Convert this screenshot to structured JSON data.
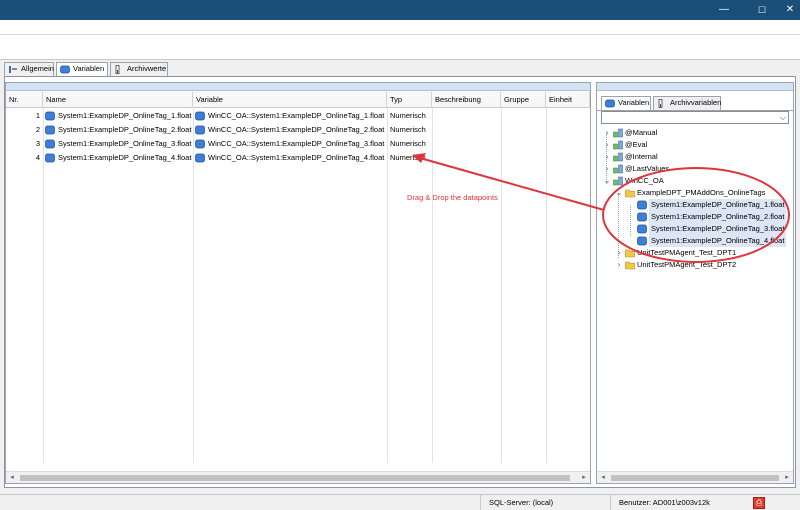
{
  "window": {
    "min_icon": "—",
    "max_icon": "☐",
    "close_icon": "✕"
  },
  "tabs": [
    {
      "label": "Allgemein",
      "icon": "tool-icon"
    },
    {
      "label": "Variablen",
      "icon": "database-icon",
      "active": true
    },
    {
      "label": "Archivwerte",
      "icon": "archive-icon"
    }
  ],
  "grid": {
    "columns": [
      "Nr.",
      "Name",
      "Variable",
      "Typ",
      "Beschreibung",
      "Gruppe",
      "Einheit"
    ],
    "rows": [
      {
        "nr": "1",
        "name": "System1:ExampleDP_OnlineTag_1.float",
        "variable": "WinCC_OA::System1:ExampleDP_OnlineTag_1.float",
        "typ": "Numerisch"
      },
      {
        "nr": "2",
        "name": "System1:ExampleDP_OnlineTag_2.float",
        "variable": "WinCC_OA::System1:ExampleDP_OnlineTag_2.float",
        "typ": "Numerisch"
      },
      {
        "nr": "3",
        "name": "System1:ExampleDP_OnlineTag_3.float",
        "variable": "WinCC_OA::System1:ExampleDP_OnlineTag_3.float",
        "typ": "Numerisch"
      },
      {
        "nr": "4",
        "name": "System1:ExampleDP_OnlineTag_4.float",
        "variable": "WinCC_OA::System1:ExampleDP_OnlineTag_4.float",
        "typ": "Numerisch"
      }
    ],
    "scroll_left": "◂",
    "scroll_right": "▸"
  },
  "annotation": {
    "text": "Drag & Drop the datapoints",
    "color": "#e0343c"
  },
  "right_panel": {
    "tabs": [
      {
        "label": "Variablen",
        "icon": "database-icon",
        "active": true
      },
      {
        "label": "Archivvariablen",
        "icon": "archive-icon"
      }
    ],
    "combo_value": "",
    "combo_arrow": "⌵",
    "tree": {
      "manual": "@Manual",
      "eval": "@Eval",
      "internal": "@Internal",
      "lastvalues": "@LastValues",
      "wincc": "WinCC_OA",
      "example_dpt": "ExampleDPT_PMAddOns_OnlineTags",
      "tag1": "System1:ExampleDP_OnlineTag_1.float",
      "tag2": "System1:ExampleDP_OnlineTag_2.float",
      "tag3": "System1:ExampleDP_OnlineTag_3.float",
      "tag4": "System1:ExampleDP_OnlineTag_4.float",
      "dpt1": "UnitTestPMAgent_Test_DPT1",
      "dpt2": "UnitTestPMAgent_Test_DPT2",
      "collapsed": "›",
      "expanded": "⌄"
    }
  },
  "status": {
    "server": "SQL-Server: (local)",
    "user": "Benutzer: AD001\\z003v12k",
    "icon": "pdf-icon",
    "icon_glyph": "⎙"
  }
}
